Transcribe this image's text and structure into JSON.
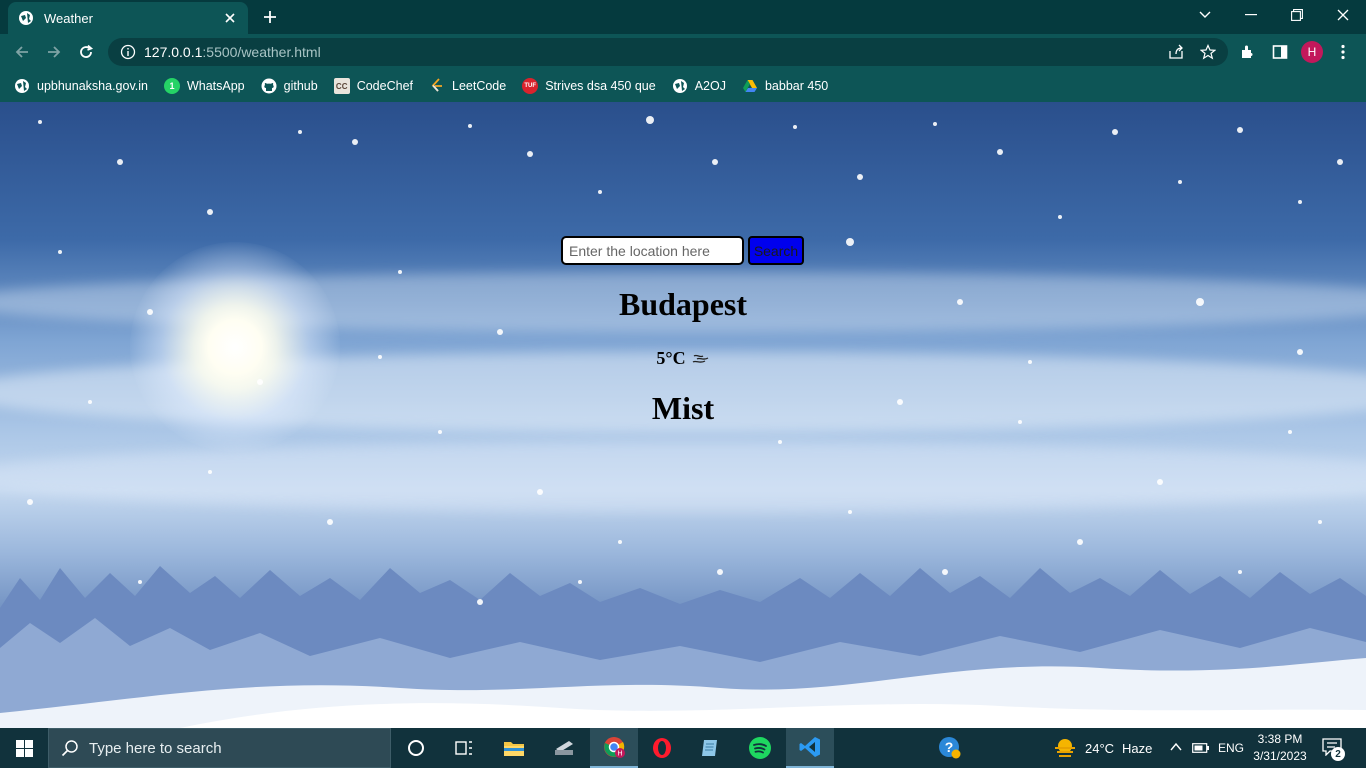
{
  "browser": {
    "tab_title": "Weather",
    "url_host": "127.0.0.1",
    "url_path": ":5500/weather.html",
    "profile_initial": "H",
    "accent_color": "#0d5556"
  },
  "bookmarks": [
    {
      "label": "upbhunaksha.gov.in",
      "icon": "globe-icon",
      "color": "#0d5556"
    },
    {
      "label": "WhatsApp",
      "icon": "whatsapp-icon",
      "color": "#25d366"
    },
    {
      "label": "github",
      "icon": "github-icon",
      "color": "#0d5556"
    },
    {
      "label": "CodeChef",
      "icon": "codechef-icon",
      "color": "#5b4638"
    },
    {
      "label": "LeetCode",
      "icon": "leetcode-icon",
      "color": "#0d5556"
    },
    {
      "label": "Strives dsa 450 que",
      "icon": "tuf-icon",
      "color": "#d9232d"
    },
    {
      "label": "A2OJ",
      "icon": "globe-icon",
      "color": "#0d5556"
    },
    {
      "label": "babbar 450",
      "icon": "drive-icon",
      "color": "#0d5556"
    }
  ],
  "page": {
    "search_placeholder": "Enter the location here",
    "search_value": "",
    "search_button": "Search",
    "city": "Budapest",
    "temperature": "5°C",
    "condition": "Mist"
  },
  "taskbar": {
    "search_placeholder": "Type here to search",
    "weather_temp": "24°C",
    "weather_desc": "Haze",
    "language": "ENG",
    "time": "3:38 PM",
    "date": "3/31/2023",
    "notification_count": "2"
  }
}
